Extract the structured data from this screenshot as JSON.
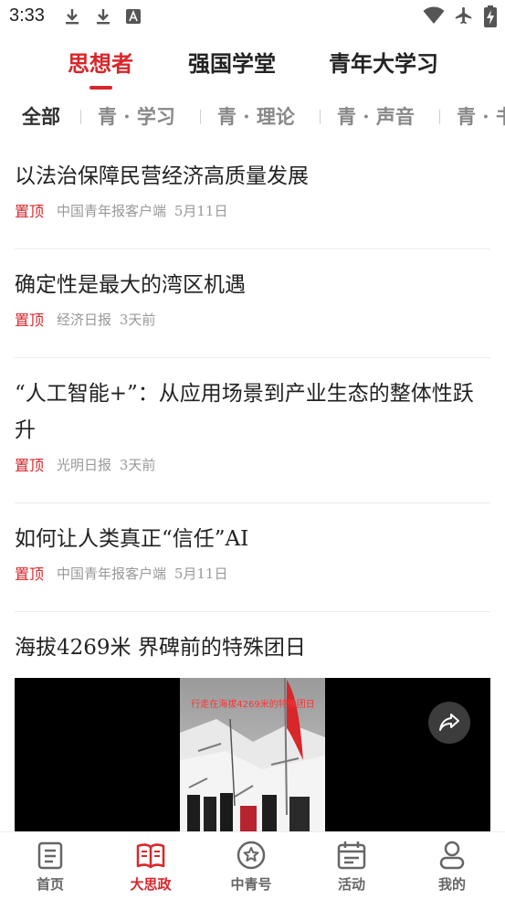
{
  "status_bar": {
    "time": "3:33"
  },
  "top_tabs": [
    {
      "label": "思想者",
      "active": true
    },
    {
      "label": "强国学堂",
      "active": false
    },
    {
      "label": "青年大学习",
      "active": false
    }
  ],
  "sub_tabs": [
    {
      "label": "全部",
      "active": true
    },
    {
      "label": "青 · 学习",
      "active": false
    },
    {
      "label": "青 · 理论",
      "active": false
    },
    {
      "label": "青 · 声音",
      "active": false
    },
    {
      "label": "青 · 书",
      "active": false
    }
  ],
  "articles": [
    {
      "title": "以法治保障民营经济高质量发展",
      "pin": "置顶",
      "source": "中国青年报客户端",
      "time": "5月11日"
    },
    {
      "title": "确定性是最大的湾区机遇",
      "pin": "置顶",
      "source": "经济日报",
      "time": "3天前"
    },
    {
      "title": "“人工智能+”：从应用场景到产业生态的整体性跃升",
      "pin": "置顶",
      "source": "光明日报",
      "time": "3天前"
    },
    {
      "title": "如何让人类真正“信任”AI",
      "pin": "置顶",
      "source": "中国青年报客户端",
      "time": "5月11日"
    },
    {
      "title": "海拔4269米 界碑前的特殊团日"
    }
  ],
  "video": {
    "caption": "行走在海拔4269米的特殊团日",
    "share_icon": "share-icon"
  },
  "bottom_nav": [
    {
      "label": "首页",
      "icon": "home-doc-icon",
      "active": false
    },
    {
      "label": "大思政",
      "icon": "open-book-icon",
      "active": true
    },
    {
      "label": "中青号",
      "icon": "star-badge-icon",
      "active": false
    },
    {
      "label": "活动",
      "icon": "calendar-icon",
      "active": false
    },
    {
      "label": "我的",
      "icon": "user-icon",
      "active": false
    }
  ],
  "colors": {
    "accent": "#d9262a",
    "muted": "#999999",
    "text": "#222222"
  }
}
